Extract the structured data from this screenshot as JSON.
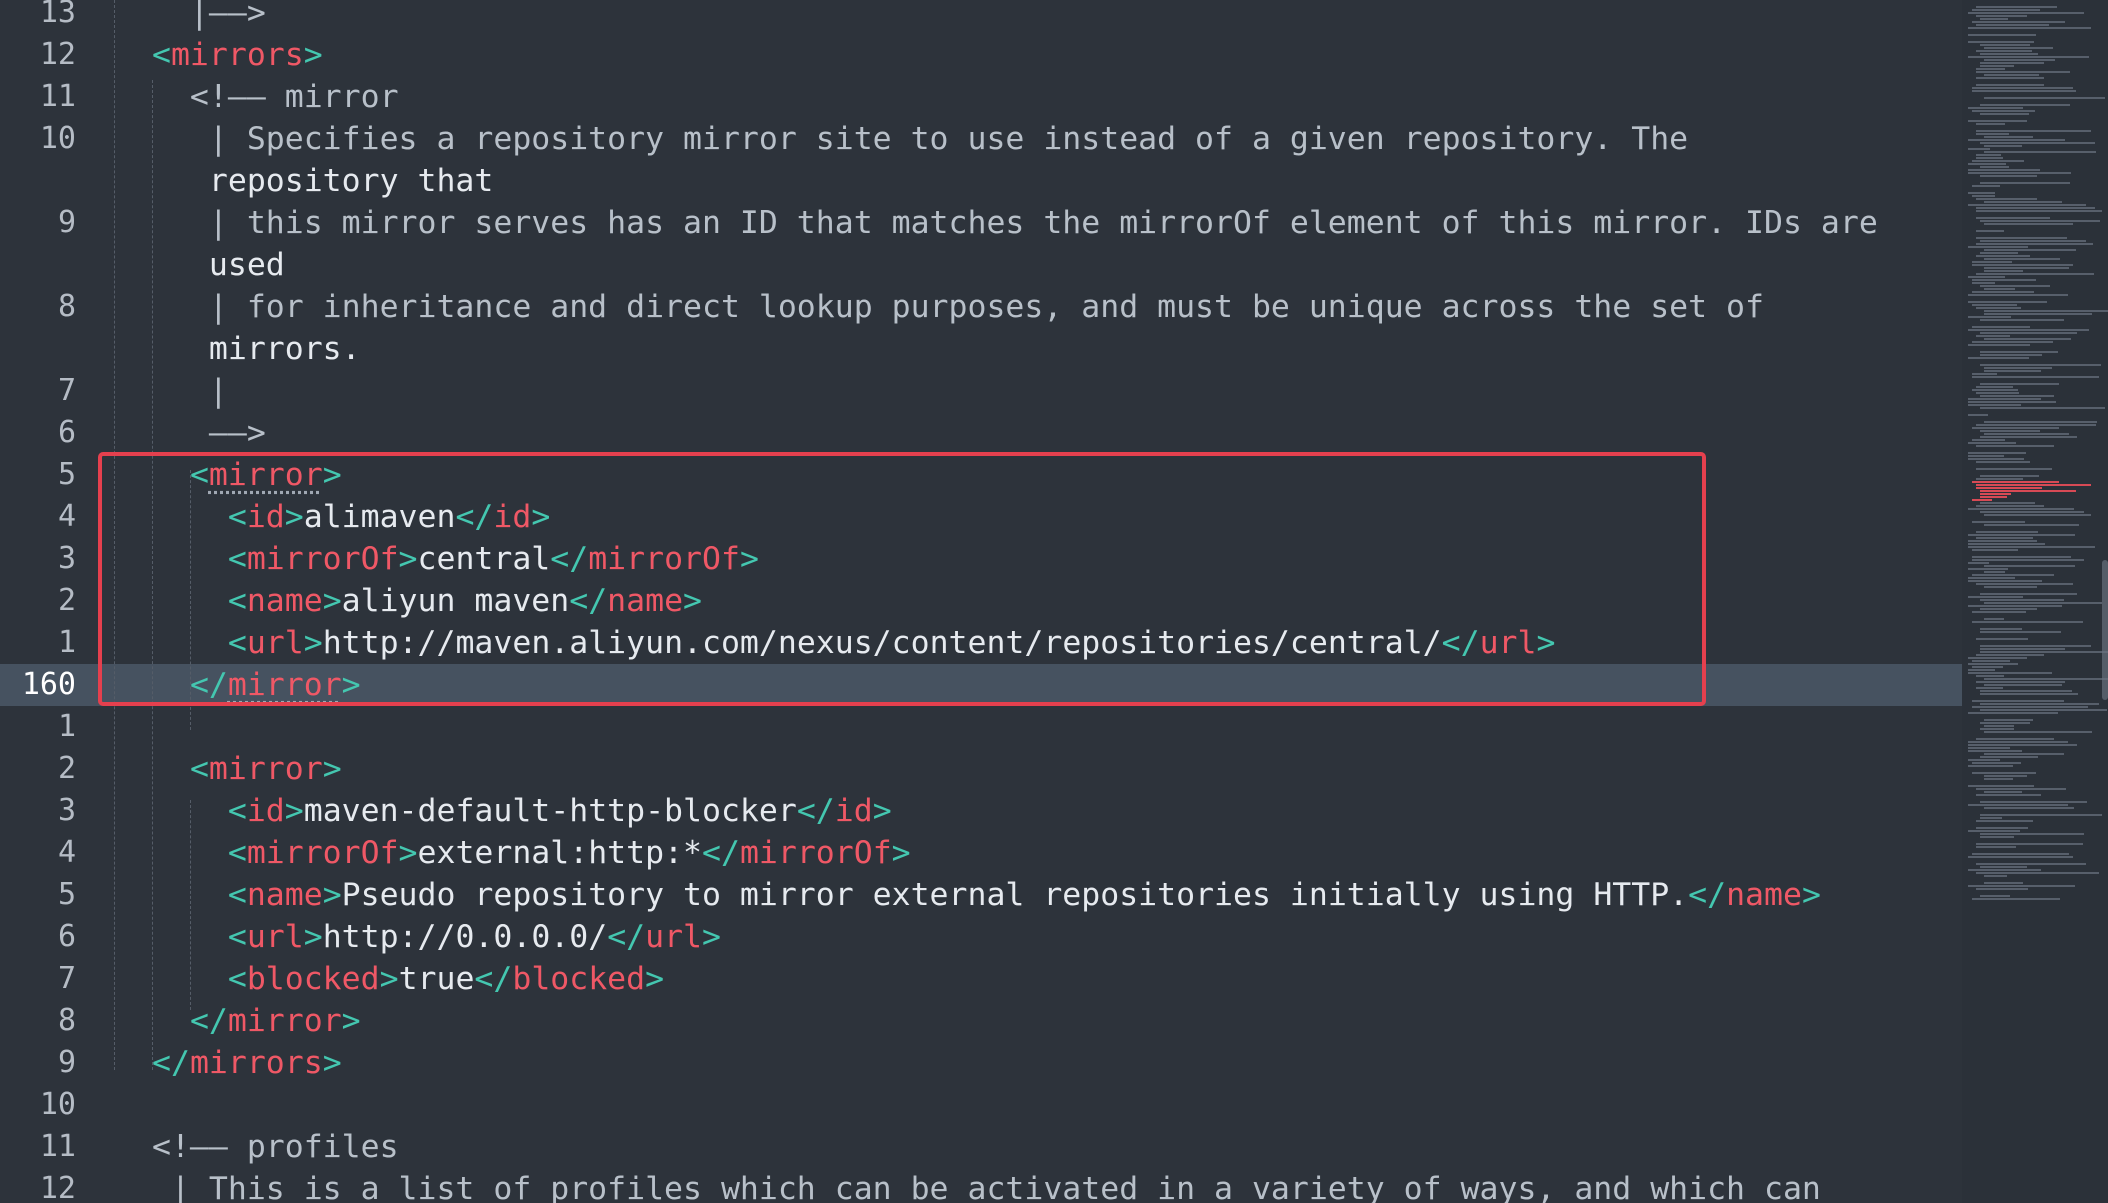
{
  "editor": {
    "lines": [
      {
        "num": "13",
        "indent": 1,
        "code": "  |——>"
      },
      {
        "num": "12",
        "indent": 0,
        "code": "<mirrors>"
      },
      {
        "num": "11",
        "indent": 1,
        "code": "  <!—— mirror"
      },
      {
        "num": "10",
        "indent": 1,
        "code": "   | Specifies a repository mirror site to use instead of a given repository. The"
      },
      {
        "num": "",
        "indent": 1,
        "code": "   repository that"
      },
      {
        "num": "9",
        "indent": 1,
        "code": "   | this mirror serves has an ID that matches the mirrorOf element of this mirror. IDs are"
      },
      {
        "num": "",
        "indent": 1,
        "code": "   used"
      },
      {
        "num": "8",
        "indent": 1,
        "code": "   | for inheritance and direct lookup purposes, and must be unique across the set of"
      },
      {
        "num": "",
        "indent": 1,
        "code": "   mirrors."
      },
      {
        "num": "7",
        "indent": 1,
        "code": "   |"
      },
      {
        "num": "6",
        "indent": 1,
        "code": "   ——>"
      },
      {
        "num": "5",
        "indent": 1,
        "code": "  <mirror>"
      },
      {
        "num": "4",
        "indent": 2,
        "code": "    <id>alimaven</id>"
      },
      {
        "num": "3",
        "indent": 2,
        "code": "    <mirrorOf>central</mirrorOf>"
      },
      {
        "num": "2",
        "indent": 2,
        "code": "    <name>aliyun maven</name>"
      },
      {
        "num": "1",
        "indent": 2,
        "code": "    <url>http://maven.aliyun.com/nexus/content/repositories/central/</url>"
      },
      {
        "num": "160",
        "indent": 1,
        "code": "  </mirror>",
        "current": true
      },
      {
        "num": "1",
        "indent": 0,
        "code": ""
      },
      {
        "num": "2",
        "indent": 1,
        "code": "  <mirror>"
      },
      {
        "num": "3",
        "indent": 2,
        "code": "    <id>maven-default-http-blocker</id>"
      },
      {
        "num": "4",
        "indent": 2,
        "code": "    <mirrorOf>external:http:*</mirrorOf>"
      },
      {
        "num": "5",
        "indent": 2,
        "code": "    <name>Pseudo repository to mirror external repositories initially using HTTP.</name>"
      },
      {
        "num": "6",
        "indent": 2,
        "code": "    <url>http://0.0.0.0/</url>"
      },
      {
        "num": "7",
        "indent": 2,
        "code": "    <blocked>true</blocked>"
      },
      {
        "num": "8",
        "indent": 1,
        "code": "  </mirror>"
      },
      {
        "num": "9",
        "indent": 0,
        "code": "</mirrors>"
      },
      {
        "num": "10",
        "indent": 0,
        "code": ""
      },
      {
        "num": "11",
        "indent": 0,
        "code": "<!—— profiles"
      },
      {
        "num": "12",
        "indent": 0,
        "code": " | This is a list of profiles which can be activated in a variety of ways, and which can"
      }
    ]
  },
  "colors": {
    "background": "#2d333b",
    "current_line": "#465260",
    "bracket": "#44c7b0",
    "tag_name": "#ef5866",
    "highlight_box": "#e5404e"
  }
}
